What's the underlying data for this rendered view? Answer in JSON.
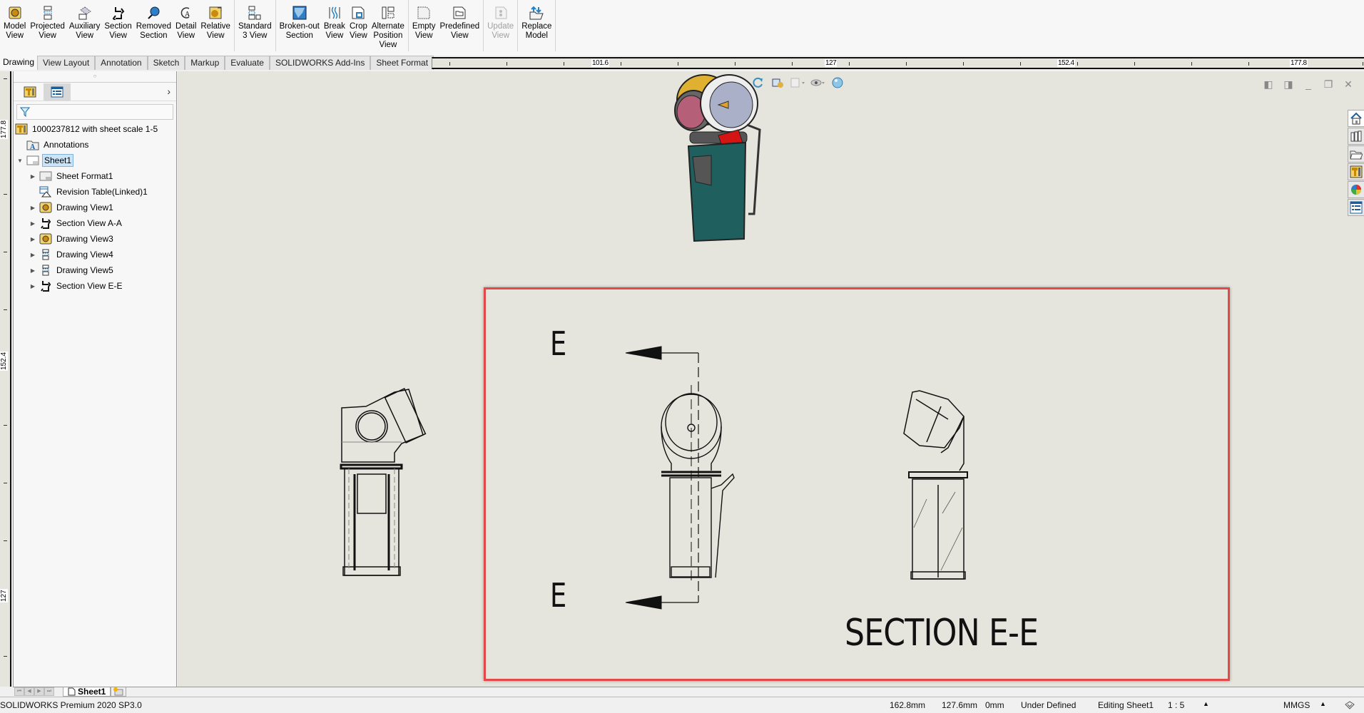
{
  "ribbon": {
    "groups": [
      [
        {
          "id": "model-view",
          "label": [
            "Model",
            "View"
          ],
          "icon": "model-view-icon"
        },
        {
          "id": "projected-view",
          "label": [
            "Projected",
            "View"
          ],
          "icon": "projected-view-icon"
        },
        {
          "id": "auxiliary-view",
          "label": [
            "Auxiliary",
            "View"
          ],
          "icon": "auxiliary-view-icon"
        },
        {
          "id": "section-view",
          "label": [
            "Section",
            "View"
          ],
          "icon": "section-view-icon"
        },
        {
          "id": "removed-section",
          "label": [
            "Removed",
            "Section"
          ],
          "icon": "removed-section-icon"
        },
        {
          "id": "detail-view",
          "label": [
            "Detail",
            "View"
          ],
          "icon": "detail-view-icon"
        },
        {
          "id": "relative-view",
          "label": [
            "Relative",
            "View"
          ],
          "icon": "relative-view-icon"
        }
      ],
      [
        {
          "id": "standard-3-view",
          "label": [
            "Standard",
            "3 View"
          ],
          "icon": "standard-3-view-icon"
        }
      ],
      [
        {
          "id": "broken-out-section",
          "label": [
            "Broken-out",
            "Section"
          ],
          "icon": "broken-out-section-icon"
        },
        {
          "id": "break-view",
          "label": [
            "Break",
            "View"
          ],
          "icon": "break-view-icon"
        },
        {
          "id": "crop-view",
          "label": [
            "Crop",
            "View"
          ],
          "icon": "crop-view-icon"
        },
        {
          "id": "alternate-position-view",
          "label": [
            "Alternate",
            "Position",
            "View"
          ],
          "icon": "alternate-position-view-icon"
        }
      ],
      [
        {
          "id": "empty-view",
          "label": [
            "Empty",
            "View"
          ],
          "icon": "empty-view-icon"
        },
        {
          "id": "predefined-view",
          "label": [
            "Predefined",
            "View"
          ],
          "icon": "predefined-view-icon"
        }
      ],
      [
        {
          "id": "update-view",
          "label": [
            "Update",
            "View"
          ],
          "icon": "update-view-icon",
          "disabled": true
        }
      ],
      [
        {
          "id": "replace-model",
          "label": [
            "Replace",
            "Model"
          ],
          "icon": "replace-model-icon"
        }
      ]
    ]
  },
  "tabs": [
    {
      "label": "Drawing",
      "active": true
    },
    {
      "label": "View Layout"
    },
    {
      "label": "Annotation"
    },
    {
      "label": "Sketch"
    },
    {
      "label": "Markup"
    },
    {
      "label": "Evaluate"
    },
    {
      "label": "SOLIDWORKS Add-Ins"
    },
    {
      "label": "Sheet Format"
    }
  ],
  "rulers": {
    "horizontal_labels": [
      "101.6",
      "127",
      "152.4",
      "177.8"
    ],
    "vertical_labels": [
      "177.8",
      "152.4",
      "127"
    ]
  },
  "feature_tree": {
    "root": "1000237812 with sheet scale 1-5",
    "items": [
      {
        "label": "Annotations",
        "icon": "annotations-folder-icon",
        "level": 1,
        "expander": ""
      },
      {
        "label": "Sheet1",
        "icon": "sheet-icon",
        "level": 1,
        "expander": "▼",
        "selected": true
      },
      {
        "label": "Sheet Format1",
        "icon": "sheet-format-icon",
        "level": 2,
        "expander": "▶"
      },
      {
        "label": "Revision Table(Linked)1",
        "icon": "revision-table-icon",
        "level": 2,
        "expander": ""
      },
      {
        "label": "Drawing View1",
        "icon": "drawing-view-icon",
        "level": 2,
        "expander": "▶"
      },
      {
        "label": "Section View A-A",
        "icon": "section-view-icon",
        "level": 2,
        "expander": "▶"
      },
      {
        "label": "Drawing View3",
        "icon": "drawing-view-icon",
        "level": 2,
        "expander": "▶"
      },
      {
        "label": "Drawing View4",
        "icon": "projected-view-icon",
        "level": 2,
        "expander": "▶"
      },
      {
        "label": "Drawing View5",
        "icon": "projected-view-icon",
        "level": 2,
        "expander": "▶"
      },
      {
        "label": "Section View E-E",
        "icon": "section-view-icon",
        "level": 2,
        "expander": "▶"
      }
    ]
  },
  "drawing": {
    "section_letter_top": "E",
    "section_letter_bottom": "E",
    "section_title": "SECTION E-E",
    "highlight_color": "#e54848"
  },
  "sheet_tabs": {
    "active": "Sheet1"
  },
  "status": {
    "product": "SOLIDWORKS Premium 2020 SP3.0",
    "x": "162.8mm",
    "y": "127.6mm",
    "z": "0mm",
    "definition": "Under Defined",
    "editing": "Editing Sheet1",
    "scale": "1 : 5",
    "units": "MMGS"
  }
}
